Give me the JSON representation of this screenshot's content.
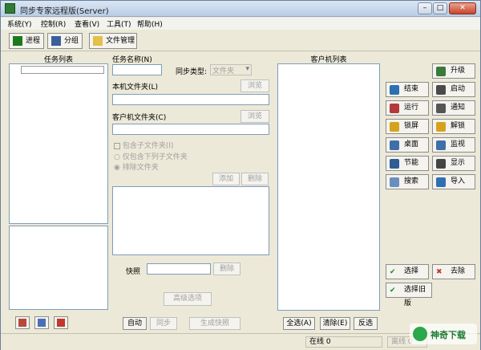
{
  "window": {
    "title": "同步专家远程版(Server)"
  },
  "menu": [
    "系统(Y)",
    "控制(R)",
    "查看(V)",
    "工具(T)",
    "帮助(H)"
  ],
  "toolbar": {
    "process": "进程",
    "group": "分组",
    "file_manage": "文件管理"
  },
  "left": {
    "task_list_label": "任务列表"
  },
  "middle": {
    "task_name_label": "任务名称(N)",
    "sync_type_label": "同步类型:",
    "sync_type_value": "文件夹",
    "local_folder_label": "本机文件夹(L)",
    "browse": "浏览",
    "client_folder_label": "客户机文件夹(C)",
    "include_sub_label": "包含子文件夹(I)",
    "only_include_label": "仅包含下列子文件夹",
    "exclude_label": "排除文件夹",
    "add": "添加",
    "delete": "删除",
    "snapshot_label": "快照",
    "snapshot_delete": "删除",
    "advanced": "高级选项",
    "auto": "自动",
    "sync": "同步",
    "gen_snapshot": "生成快照"
  },
  "right": {
    "client_list_label": "客户机列表",
    "select_all": "全选(A)",
    "clear": "清除(E)",
    "invert": "反选"
  },
  "controls": {
    "upgrade": "升级",
    "end": "结束",
    "start": "启动",
    "run": "运行",
    "notify": "通知",
    "lock": "锁屏",
    "unlock": "解锁",
    "desktop": "桌面",
    "monitor": "监视",
    "save_power": "节能",
    "display": "显示",
    "search": "搜索",
    "import": "导入",
    "select": "选择",
    "remove": "去除",
    "select_old": "选择旧版"
  },
  "status": {
    "online": "在线 0",
    "offline": "离线 0"
  },
  "watermark": "神奇下载"
}
